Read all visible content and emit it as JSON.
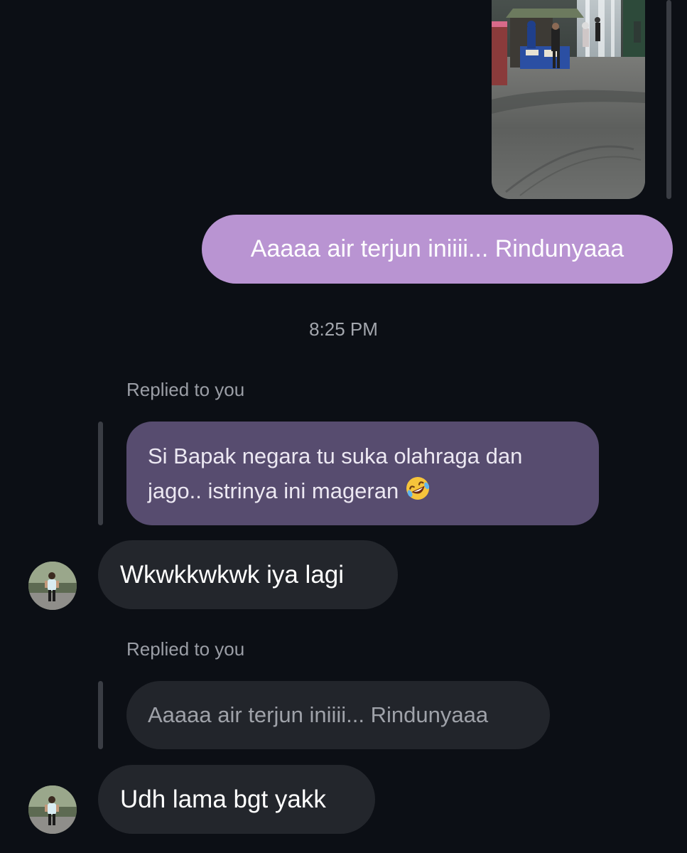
{
  "messages": {
    "outgoing_1": "Aaaaa air terjun iniiii... Rindunyaaa",
    "timestamp": "8:25 PM",
    "reply_1": {
      "label": "Replied to you",
      "quoted_text_line1": "Si Bapak negara tu suka olahraga dan",
      "quoted_text_line2": "jago.. istrinya ini mageran",
      "quoted_emoji": "rolling-on-floor-laughing-emoji",
      "message": "Wkwkkwkwk iya lagi"
    },
    "reply_2": {
      "label": "Replied to you",
      "quoted_text": "Aaaaa air terjun iniiii... Rindunyaaa",
      "message": "Udh lama bgt yakk"
    }
  },
  "colors": {
    "background": "#0c0f15",
    "outgoing_bubble": "#b994d2",
    "incoming_bubble": "#23262c",
    "quoted_outgoing": "#574c6f",
    "quoted_neutral": "#22252b"
  },
  "icons": {
    "emoji": "rolling-on-floor-laughing-emoji",
    "avatar": "user-avatar-runner"
  }
}
